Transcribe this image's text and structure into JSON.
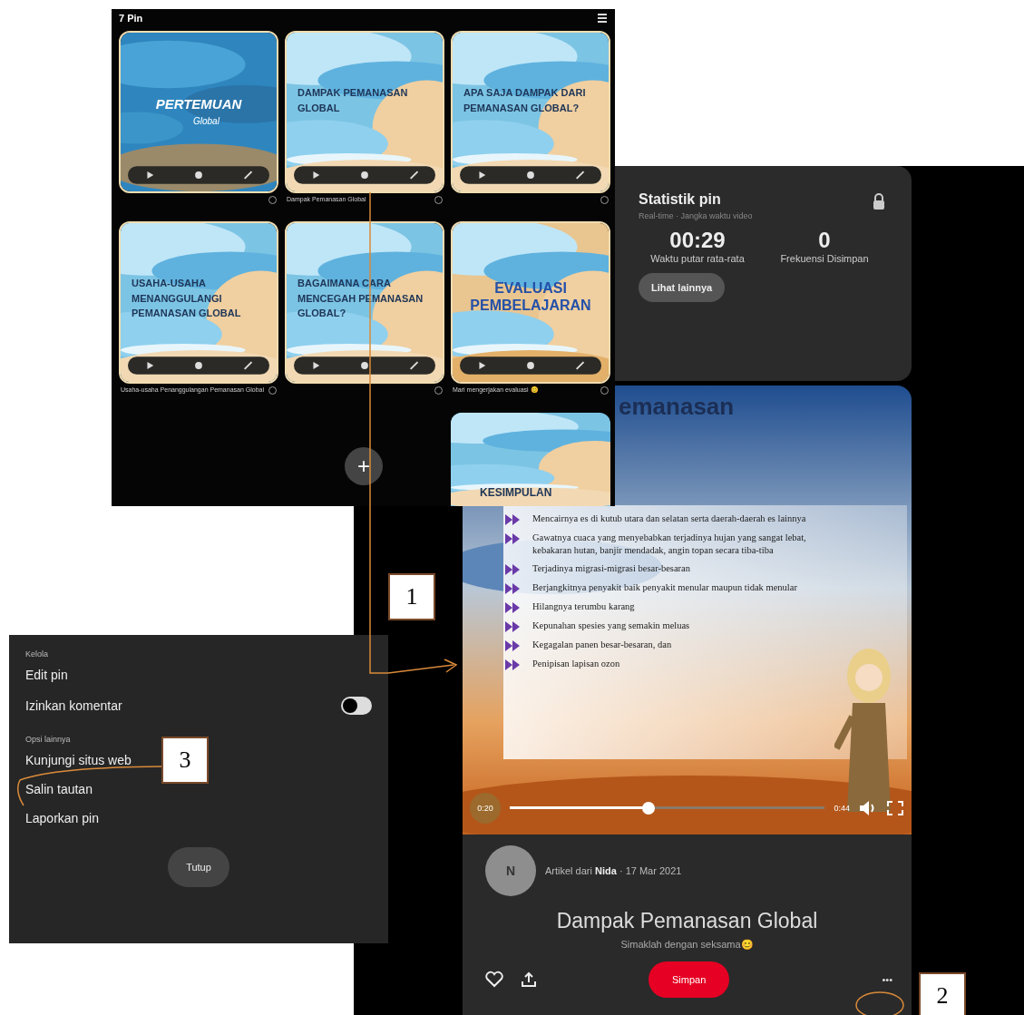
{
  "pin_grid": {
    "title": "7 Pin",
    "add_button": "+",
    "tiles": [
      {
        "kind": "logo",
        "text": "PERTEMUAN",
        "subtext": "Global"
      },
      {
        "kind": "title",
        "text": "DAMPAK PEMANASAN GLOBAL",
        "caption": "Dampak Pemanasan Global"
      },
      {
        "kind": "title",
        "text": "APA SAJA DAMPAK DARI PEMANASAN GLOBAL?"
      },
      {
        "kind": "title",
        "text": "USAHA-USAHA MENANGGULANGI PEMANASAN GLOBAL",
        "caption": "Usaha-usaha Penanggulangan Pemanasan Global"
      },
      {
        "kind": "title",
        "text": "BAGAIMANA CARA MENCEGAH PEMANASAN GLOBAL?"
      },
      {
        "kind": "evaluation",
        "text": "EVALUASI PEMBELAJARAN",
        "caption": "Mari mengerjakan evaluasi 😊"
      }
    ],
    "partial_tile": {
      "text": "KESIMPULAN"
    }
  },
  "stats": {
    "title": "Statistik pin",
    "subtitle": "Real-time · Jangka waktu video",
    "metrics": [
      {
        "value": "00:29",
        "label": "Waktu putar rata-rata"
      },
      {
        "value": "0",
        "label": "Frekuensi Disimpan"
      }
    ],
    "button": "Lihat lainnya"
  },
  "video": {
    "heading": "emanasan",
    "bullets": [
      "Mencairnya es di kutub utara dan selatan serta daerah-daerah es lainnya",
      "Gawatnya cuaca yang menyebabkan terjadinya hujan yang sangat lebat, kebakaran hutan, banjir mendadak, angin topan secara tiba-tiba",
      "Terjadinya migrasi-migrasi besar-besaran",
      "Berjangkitnya penyakit baik penyakit menular maupun tidak menular",
      "Hilangnya terumbu karang",
      "Kepunahan spesies yang semakin meluas",
      "Kegagalan panen besar-besaran, dan",
      "Penipisan lapisan ozon"
    ],
    "elapsed": "0:20",
    "remaining": "0:44",
    "progress": {
      "level": 0.44
    }
  },
  "pin_info": {
    "avatar": "N",
    "meta": "Artikel dari **Nida** · 17 Mar 2021",
    "title": "Dampak Pemanasan Global",
    "description": "Simaklah dengan seksama😊",
    "save_button": "Simpan",
    "more_button": "•••"
  },
  "menu": {
    "section_1": "Kelola",
    "items_1": [
      {
        "kind": "link",
        "label": "Edit pin"
      },
      {
        "kind": "toggle",
        "label": "Izinkan komentar",
        "on": false
      }
    ],
    "section_2": "Opsi lainnya",
    "items_2": [
      {
        "kind": "link",
        "label": "Kunjungi situs web"
      },
      {
        "kind": "link",
        "label": "Salin tautan"
      },
      {
        "kind": "link",
        "label": "Laporkan pin"
      }
    ],
    "close_button": "Tutup"
  },
  "annotations": [
    {
      "label": "1"
    },
    {
      "label": "2"
    },
    {
      "label": "3"
    }
  ]
}
